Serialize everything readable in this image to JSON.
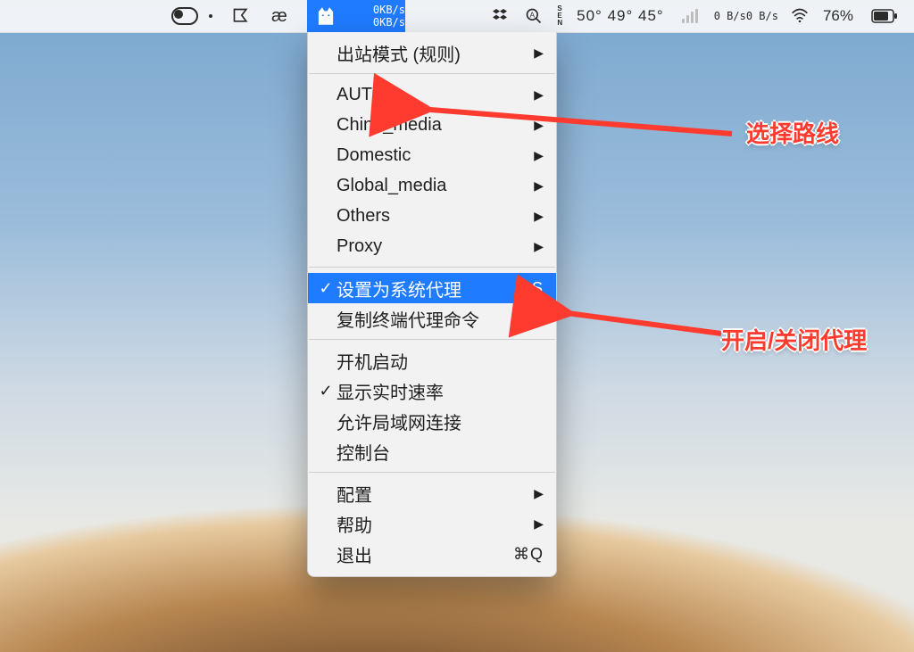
{
  "menubar": {
    "clash_rate_up": "0KB/s",
    "clash_rate_down": "0KB/s",
    "temps": "50°  49°  45°",
    "net_up": "0 B/s",
    "net_down": "0 B/s",
    "battery_pct": "76%",
    "ae_text": "æ",
    "sen_text": "S\nE\nN"
  },
  "menu": {
    "outbound": "出站模式 (规则)",
    "routes": [
      "AUTO",
      "China_media",
      "Domestic",
      "Global_media",
      "Others",
      "Proxy"
    ],
    "set_proxy": "设置为系统代理",
    "set_proxy_sc": "⌘S",
    "copy_cmd": "复制终端代理命令",
    "copy_cmd_sc": "⌘C",
    "launch_at_login": "开机启动",
    "show_rate": "显示实时速率",
    "allow_lan": "允许局域网连接",
    "console": "控制台",
    "config": "配置",
    "help": "帮助",
    "quit": "退出",
    "quit_sc": "⌘Q"
  },
  "annotations": {
    "route_label": "选择路线",
    "proxy_label": "开启/关闭代理"
  },
  "colors": {
    "highlight": "#1f7bff",
    "anno": "#ff3b2f"
  }
}
